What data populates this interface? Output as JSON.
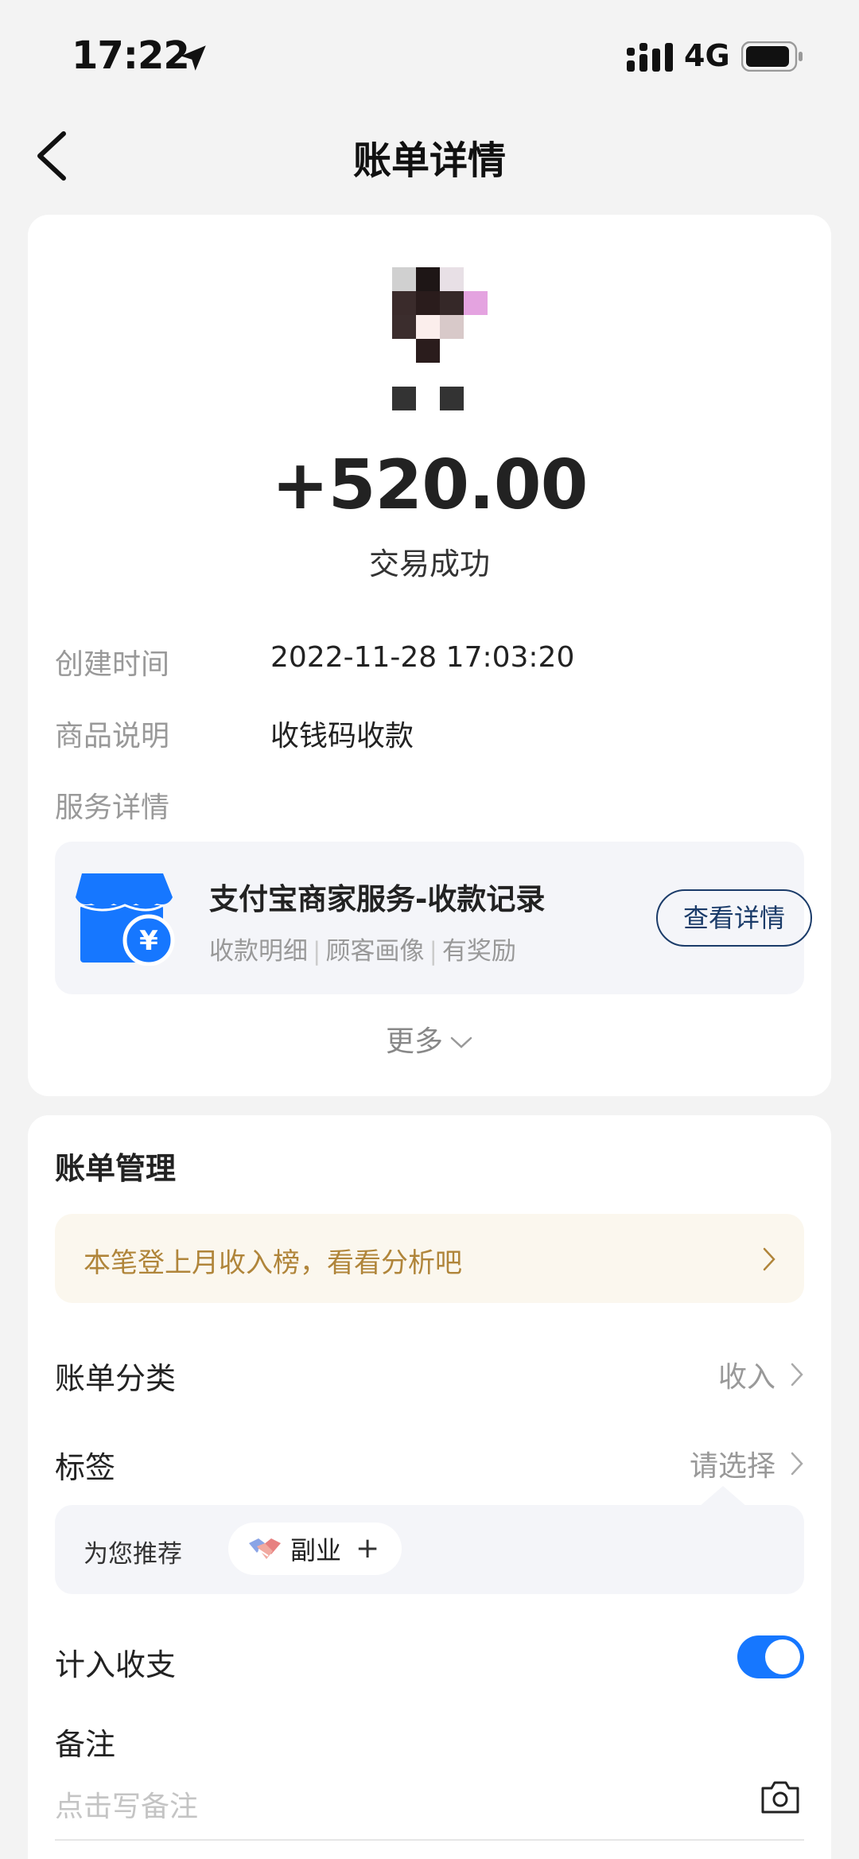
{
  "status_bar": {
    "time": "17:22",
    "network": "4G"
  },
  "nav": {
    "title": "账单详情"
  },
  "transaction": {
    "amount": "+520.00",
    "status": "交易成功",
    "rows": [
      {
        "label": "创建时间",
        "value": "2022-11-28 17:03:20"
      },
      {
        "label": "商品说明",
        "value": "收钱码收款"
      },
      {
        "label": "服务详情",
        "value": ""
      }
    ]
  },
  "service": {
    "title": "支付宝商家服务-收款记录",
    "tags": [
      "收款明细",
      "顾客画像",
      "有奖励"
    ],
    "button": "查看详情"
  },
  "more_label": "更多",
  "manage": {
    "title": "账单管理",
    "tip": "本笔登上月收入榜，看看分析吧",
    "category_label": "账单分类",
    "category_value": "收入",
    "tag_label": "标签",
    "tag_value": "请选择",
    "recommend_label": "为您推荐",
    "recommend_chip": "副业",
    "include_label": "计入收支",
    "include_enabled": true,
    "note_label": "备注",
    "note_placeholder": "点击写备注"
  },
  "colors": {
    "accent": "#1677ff",
    "tip_text": "#b0853a",
    "button_border": "#1a3b69"
  }
}
